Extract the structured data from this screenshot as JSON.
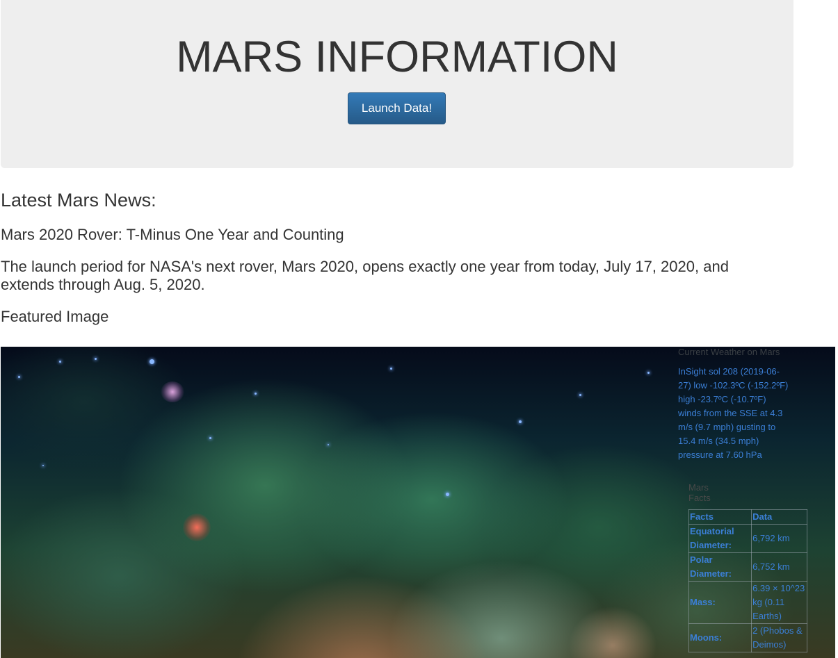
{
  "header": {
    "title": "MARS INFORMATION",
    "button_label": "Launch Data!"
  },
  "news": {
    "heading": "Latest Mars News:",
    "title": "Mars 2020 Rover: T-Minus One Year and Counting",
    "paragraph": "The launch period for NASA's next rover, Mars 2020, opens exactly one year from today, July 17, 2020, and extends through Aug. 5, 2020."
  },
  "featured": {
    "label": "Featured Image"
  },
  "weather": {
    "heading": "Current Weather on Mars",
    "text": "InSight sol 208 (2019-06-27) low -102.3ºC (-152.2ºF) high -23.7ºC (-10.7ºF) winds from the SSE at 4.3 m/s (9.7 mph) gusting to 15.4 m/s (34.5 mph) pressure at 7.60 hPa"
  },
  "facts": {
    "caption": "Mars Facts",
    "headers": [
      "Facts",
      "Data"
    ],
    "rows": [
      {
        "key": "Equatorial Diameter:",
        "value": "6,792 km"
      },
      {
        "key": "Polar Diameter:",
        "value": "6,752 km"
      },
      {
        "key": "Mass:",
        "value": "6.39 × 10^23 kg (0.11 Earths)"
      },
      {
        "key": "Moons:",
        "value": "2 (Phobos & Deimos)"
      }
    ]
  },
  "colors": {
    "jumbotron_bg": "#eeeeee",
    "button_primary": "#337ab7",
    "facts_text": "#3b7fd6"
  }
}
